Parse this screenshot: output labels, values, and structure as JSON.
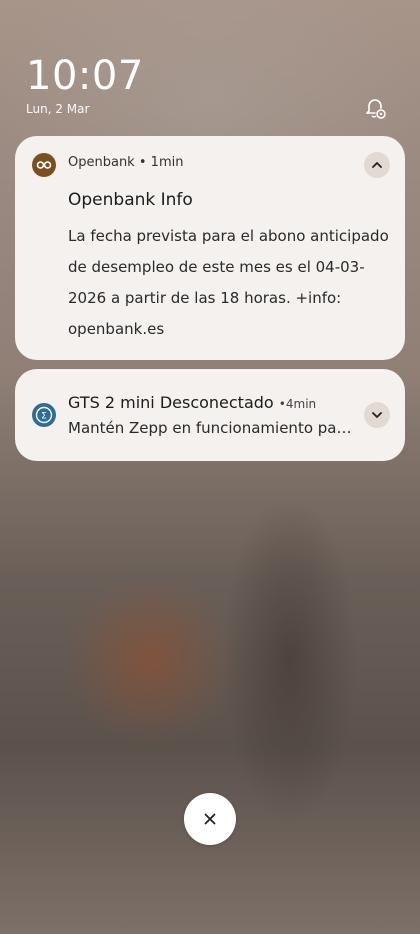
{
  "status_bar": {
    "time": "10:07",
    "date": "Lun, 2 Mar"
  },
  "notifications": [
    {
      "app_name": "Openbank",
      "time_ago": "1min",
      "title": "Openbank Info",
      "body": "La fecha prevista para el abono anticipado de desempleo de este mes es el 04-03-2026 a partir de las 18 horas. +info: openbank.es",
      "icon": "openbank-logo-icon",
      "expanded": true
    },
    {
      "title": "GTS 2 mini Desconectado",
      "time_ago": "4min",
      "body": "Mantén Zepp en funcionamiento para recibir notificaciones",
      "icon": "zepp-logo-icon",
      "expanded": false
    }
  ],
  "separator": "•",
  "colors": {
    "card_background": "#f4f1ee",
    "openbank_brand": "#7a5020",
    "zepp_brand": "#2e6a9a"
  },
  "icons": {
    "settings": "notification-settings-icon",
    "collapse": "chevron-up-icon",
    "expand": "chevron-down-icon",
    "clear": "close-icon"
  }
}
